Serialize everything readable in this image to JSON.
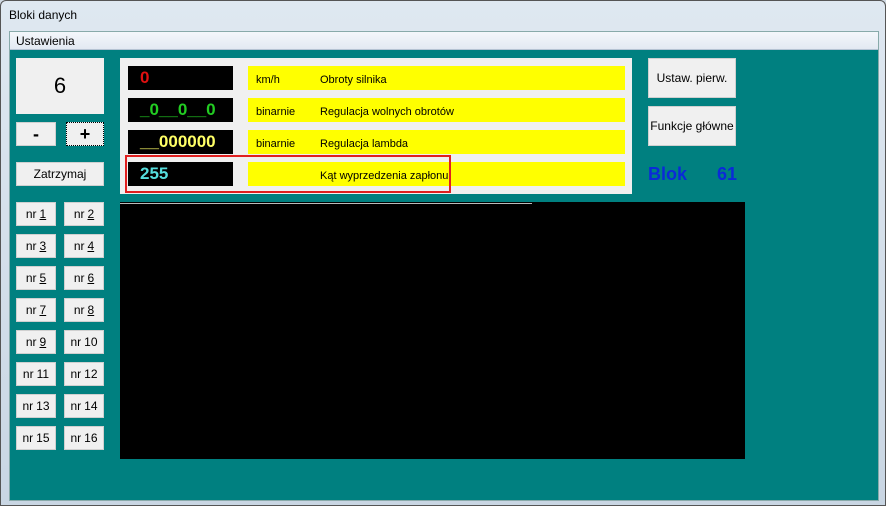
{
  "window": {
    "title": "Bloki danych"
  },
  "menu": {
    "items": [
      "Ustawienia"
    ]
  },
  "left": {
    "counter": "6",
    "minus": "-",
    "plus": "+",
    "stop": "Zatrzymaj",
    "nr": [
      "1",
      "2",
      "3",
      "4",
      "5",
      "6",
      "7",
      "8",
      "9",
      "10",
      "11",
      "12",
      "13",
      "14",
      "15",
      "16"
    ],
    "nr_prefix": "nr"
  },
  "rows": [
    {
      "value": "0",
      "color": "#e01010",
      "unit": "km/h",
      "desc": "Obroty silnika"
    },
    {
      "value": "_0__0__0",
      "color": "#22cc22",
      "unit": "binarnie",
      "desc": "Regulacja wolnych obrotów"
    },
    {
      "value": "__000000",
      "color": "#ffff66",
      "unit": "binarnie",
      "desc": "Regulacja lambda"
    },
    {
      "value": "255",
      "color": "#55dddd",
      "unit": "",
      "desc": "Kąt wyprzedzenia zapłonu",
      "highlighted": true
    }
  ],
  "right": {
    "initial_settings": "Ustaw. pierw.",
    "main_functions": "Funkcje główne",
    "block_label": "Blok",
    "block_number": "61"
  },
  "colors": {
    "background": "#008080",
    "highlight": "#e02020",
    "value_bg": "#000000",
    "desc_bg": "#ffff00",
    "block_text": "#0a2ad8"
  }
}
